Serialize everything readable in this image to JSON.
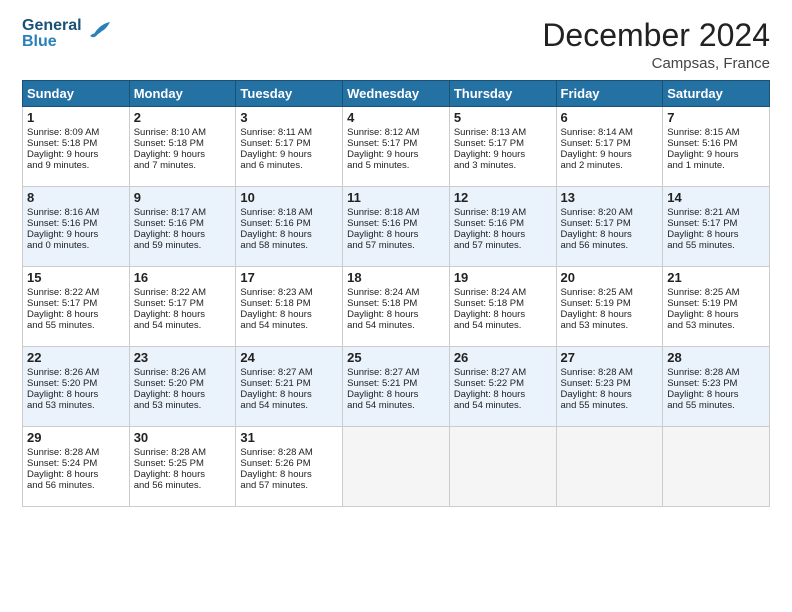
{
  "header": {
    "logo_line1": "General",
    "logo_line2": "Blue",
    "title": "December 2024",
    "subtitle": "Campsas, France"
  },
  "weekdays": [
    "Sunday",
    "Monday",
    "Tuesday",
    "Wednesday",
    "Thursday",
    "Friday",
    "Saturday"
  ],
  "weeks": [
    [
      {
        "day": "1",
        "lines": [
          "Sunrise: 8:09 AM",
          "Sunset: 5:18 PM",
          "Daylight: 9 hours",
          "and 9 minutes."
        ]
      },
      {
        "day": "2",
        "lines": [
          "Sunrise: 8:10 AM",
          "Sunset: 5:18 PM",
          "Daylight: 9 hours",
          "and 7 minutes."
        ]
      },
      {
        "day": "3",
        "lines": [
          "Sunrise: 8:11 AM",
          "Sunset: 5:17 PM",
          "Daylight: 9 hours",
          "and 6 minutes."
        ]
      },
      {
        "day": "4",
        "lines": [
          "Sunrise: 8:12 AM",
          "Sunset: 5:17 PM",
          "Daylight: 9 hours",
          "and 5 minutes."
        ]
      },
      {
        "day": "5",
        "lines": [
          "Sunrise: 8:13 AM",
          "Sunset: 5:17 PM",
          "Daylight: 9 hours",
          "and 3 minutes."
        ]
      },
      {
        "day": "6",
        "lines": [
          "Sunrise: 8:14 AM",
          "Sunset: 5:17 PM",
          "Daylight: 9 hours",
          "and 2 minutes."
        ]
      },
      {
        "day": "7",
        "lines": [
          "Sunrise: 8:15 AM",
          "Sunset: 5:16 PM",
          "Daylight: 9 hours",
          "and 1 minute."
        ]
      }
    ],
    [
      {
        "day": "8",
        "lines": [
          "Sunrise: 8:16 AM",
          "Sunset: 5:16 PM",
          "Daylight: 9 hours",
          "and 0 minutes."
        ]
      },
      {
        "day": "9",
        "lines": [
          "Sunrise: 8:17 AM",
          "Sunset: 5:16 PM",
          "Daylight: 8 hours",
          "and 59 minutes."
        ]
      },
      {
        "day": "10",
        "lines": [
          "Sunrise: 8:18 AM",
          "Sunset: 5:16 PM",
          "Daylight: 8 hours",
          "and 58 minutes."
        ]
      },
      {
        "day": "11",
        "lines": [
          "Sunrise: 8:18 AM",
          "Sunset: 5:16 PM",
          "Daylight: 8 hours",
          "and 57 minutes."
        ]
      },
      {
        "day": "12",
        "lines": [
          "Sunrise: 8:19 AM",
          "Sunset: 5:16 PM",
          "Daylight: 8 hours",
          "and 57 minutes."
        ]
      },
      {
        "day": "13",
        "lines": [
          "Sunrise: 8:20 AM",
          "Sunset: 5:17 PM",
          "Daylight: 8 hours",
          "and 56 minutes."
        ]
      },
      {
        "day": "14",
        "lines": [
          "Sunrise: 8:21 AM",
          "Sunset: 5:17 PM",
          "Daylight: 8 hours",
          "and 55 minutes."
        ]
      }
    ],
    [
      {
        "day": "15",
        "lines": [
          "Sunrise: 8:22 AM",
          "Sunset: 5:17 PM",
          "Daylight: 8 hours",
          "and 55 minutes."
        ]
      },
      {
        "day": "16",
        "lines": [
          "Sunrise: 8:22 AM",
          "Sunset: 5:17 PM",
          "Daylight: 8 hours",
          "and 54 minutes."
        ]
      },
      {
        "day": "17",
        "lines": [
          "Sunrise: 8:23 AM",
          "Sunset: 5:18 PM",
          "Daylight: 8 hours",
          "and 54 minutes."
        ]
      },
      {
        "day": "18",
        "lines": [
          "Sunrise: 8:24 AM",
          "Sunset: 5:18 PM",
          "Daylight: 8 hours",
          "and 54 minutes."
        ]
      },
      {
        "day": "19",
        "lines": [
          "Sunrise: 8:24 AM",
          "Sunset: 5:18 PM",
          "Daylight: 8 hours",
          "and 54 minutes."
        ]
      },
      {
        "day": "20",
        "lines": [
          "Sunrise: 8:25 AM",
          "Sunset: 5:19 PM",
          "Daylight: 8 hours",
          "and 53 minutes."
        ]
      },
      {
        "day": "21",
        "lines": [
          "Sunrise: 8:25 AM",
          "Sunset: 5:19 PM",
          "Daylight: 8 hours",
          "and 53 minutes."
        ]
      }
    ],
    [
      {
        "day": "22",
        "lines": [
          "Sunrise: 8:26 AM",
          "Sunset: 5:20 PM",
          "Daylight: 8 hours",
          "and 53 minutes."
        ]
      },
      {
        "day": "23",
        "lines": [
          "Sunrise: 8:26 AM",
          "Sunset: 5:20 PM",
          "Daylight: 8 hours",
          "and 53 minutes."
        ]
      },
      {
        "day": "24",
        "lines": [
          "Sunrise: 8:27 AM",
          "Sunset: 5:21 PM",
          "Daylight: 8 hours",
          "and 54 minutes."
        ]
      },
      {
        "day": "25",
        "lines": [
          "Sunrise: 8:27 AM",
          "Sunset: 5:21 PM",
          "Daylight: 8 hours",
          "and 54 minutes."
        ]
      },
      {
        "day": "26",
        "lines": [
          "Sunrise: 8:27 AM",
          "Sunset: 5:22 PM",
          "Daylight: 8 hours",
          "and 54 minutes."
        ]
      },
      {
        "day": "27",
        "lines": [
          "Sunrise: 8:28 AM",
          "Sunset: 5:23 PM",
          "Daylight: 8 hours",
          "and 55 minutes."
        ]
      },
      {
        "day": "28",
        "lines": [
          "Sunrise: 8:28 AM",
          "Sunset: 5:23 PM",
          "Daylight: 8 hours",
          "and 55 minutes."
        ]
      }
    ],
    [
      {
        "day": "29",
        "lines": [
          "Sunrise: 8:28 AM",
          "Sunset: 5:24 PM",
          "Daylight: 8 hours",
          "and 56 minutes."
        ]
      },
      {
        "day": "30",
        "lines": [
          "Sunrise: 8:28 AM",
          "Sunset: 5:25 PM",
          "Daylight: 8 hours",
          "and 56 minutes."
        ]
      },
      {
        "day": "31",
        "lines": [
          "Sunrise: 8:28 AM",
          "Sunset: 5:26 PM",
          "Daylight: 8 hours",
          "and 57 minutes."
        ]
      },
      null,
      null,
      null,
      null
    ]
  ]
}
